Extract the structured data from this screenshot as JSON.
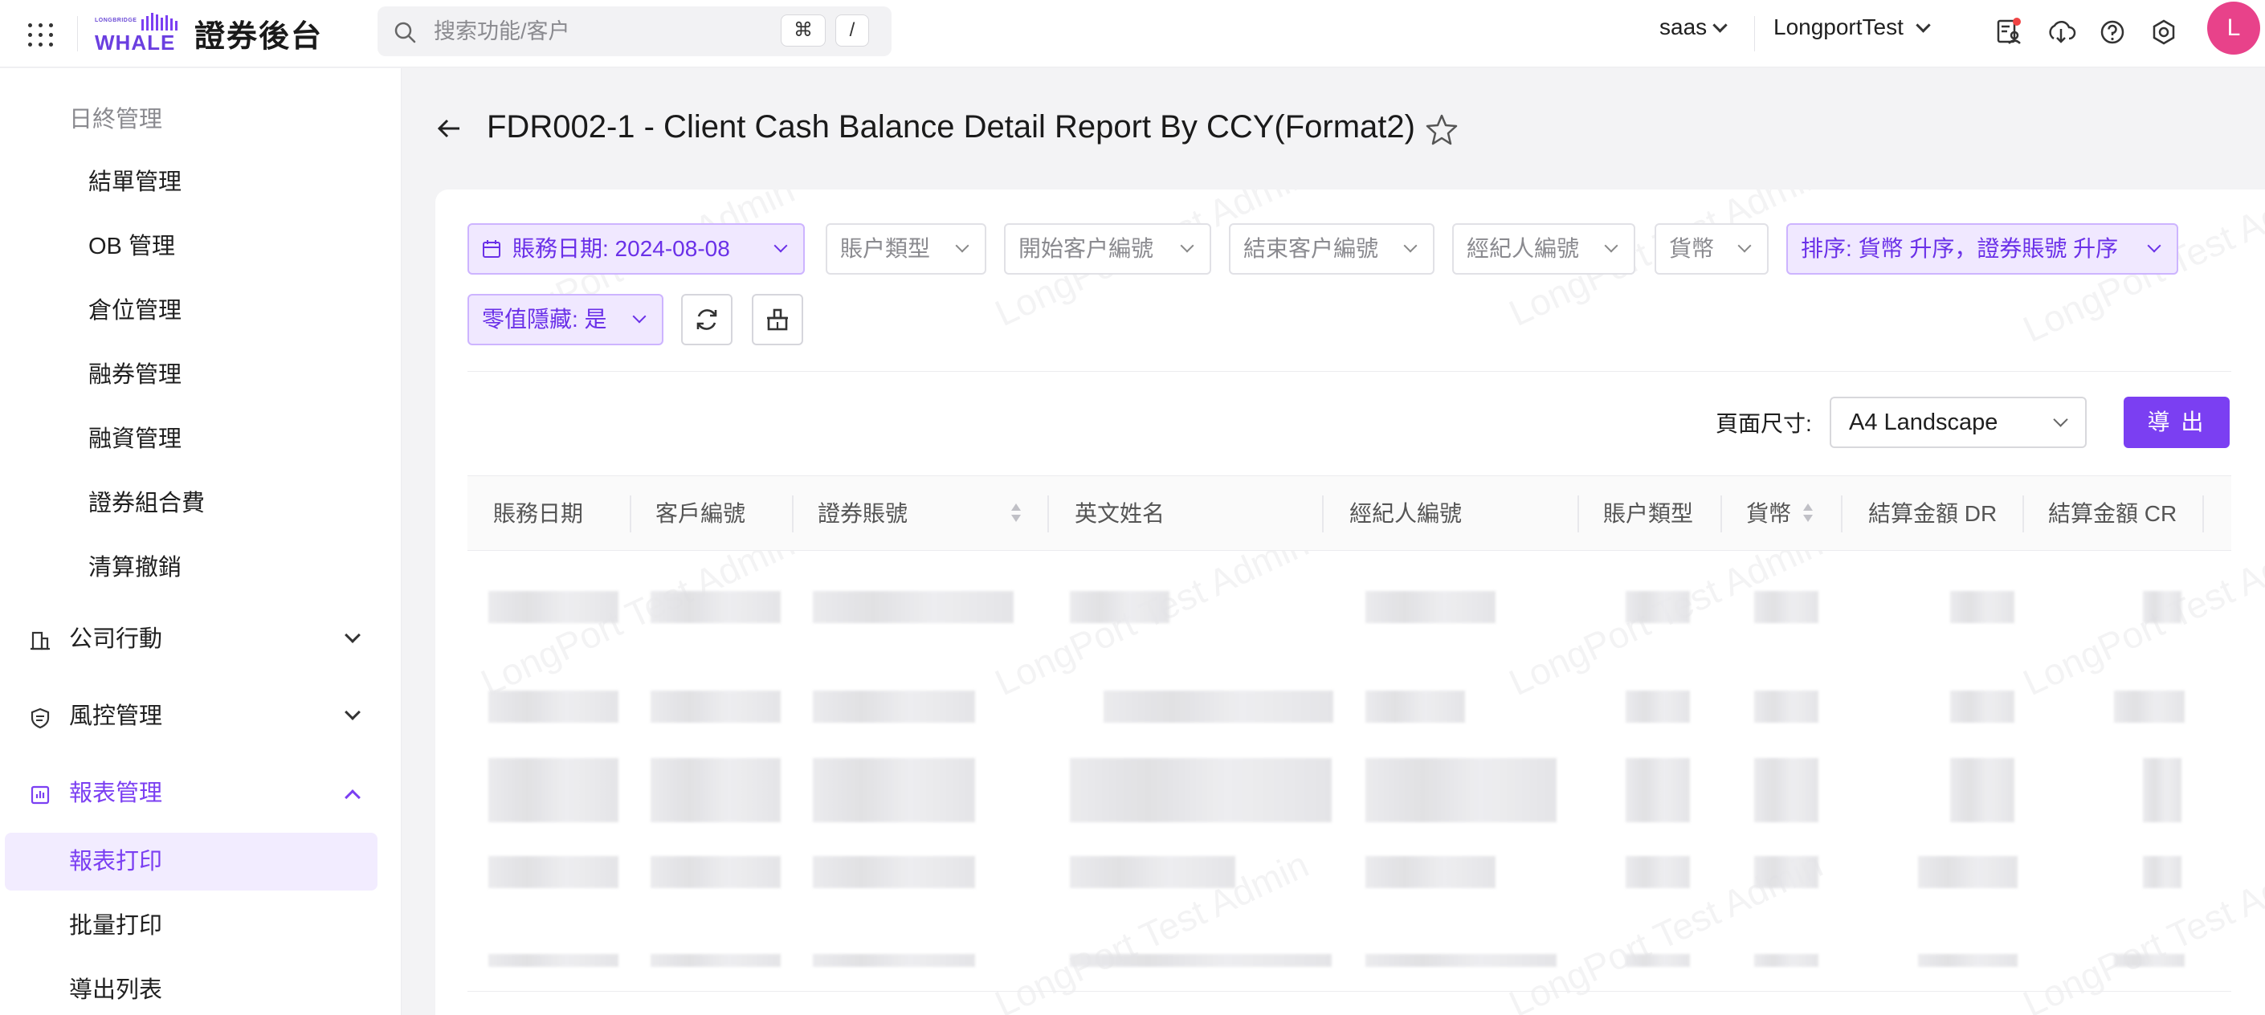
{
  "app": {
    "brand_small": "LONGBRIDGE",
    "brand_main": "WHALE",
    "title": "證券後台",
    "accent_color": "#7b3ff2"
  },
  "search": {
    "placeholder": "搜索功能/客户",
    "shortcut_key1": "⌘",
    "shortcut_key2": "/"
  },
  "topbar": {
    "tenant": "saas",
    "account": "LongportTest",
    "avatar_initial": "L",
    "icons": [
      "user-list-icon",
      "download-icon",
      "help-icon",
      "settings-icon"
    ]
  },
  "sidebar": {
    "group_title": "日終管理",
    "sub_items": [
      "結單管理",
      "OB 管理",
      "倉位管理",
      "融券管理",
      "融資管理",
      "證券組合費",
      "清算撤銷"
    ],
    "sections": [
      {
        "label": "公司行動",
        "icon": "building-icon",
        "expanded": false
      },
      {
        "label": "風控管理",
        "icon": "shield-icon",
        "expanded": false
      },
      {
        "label": "報表管理",
        "icon": "report-icon",
        "expanded": true
      }
    ],
    "report_items": [
      {
        "label": "報表打印",
        "active": true
      },
      {
        "label": "批量打印",
        "active": false
      },
      {
        "label": "導出列表",
        "active": false
      }
    ]
  },
  "page": {
    "title": "FDR002-1 - Client Cash Balance Detail Report By CCY(Format2)"
  },
  "filters": {
    "date": "賬務日期: 2024-08-08",
    "account_type": "賬户類型",
    "start_client": "開始客户編號",
    "end_client": "結束客户編號",
    "broker": "經紀人編號",
    "currency": "貨幣",
    "sort": "排序: 貨幣 升序，證券賬號 升序",
    "zero_hide": "零值隱藏: 是"
  },
  "export": {
    "page_size_label": "頁面尺寸:",
    "page_size_value": "A4 Landscape",
    "button": "導 出"
  },
  "table": {
    "columns": [
      "賬務日期",
      "客戶編號",
      "證券賬號",
      "英文姓名",
      "經紀人編號",
      "賬户類型",
      "貨幣",
      "結算金額 DR",
      "結算金額 CR"
    ]
  },
  "watermark": "LongPort Test Admin"
}
